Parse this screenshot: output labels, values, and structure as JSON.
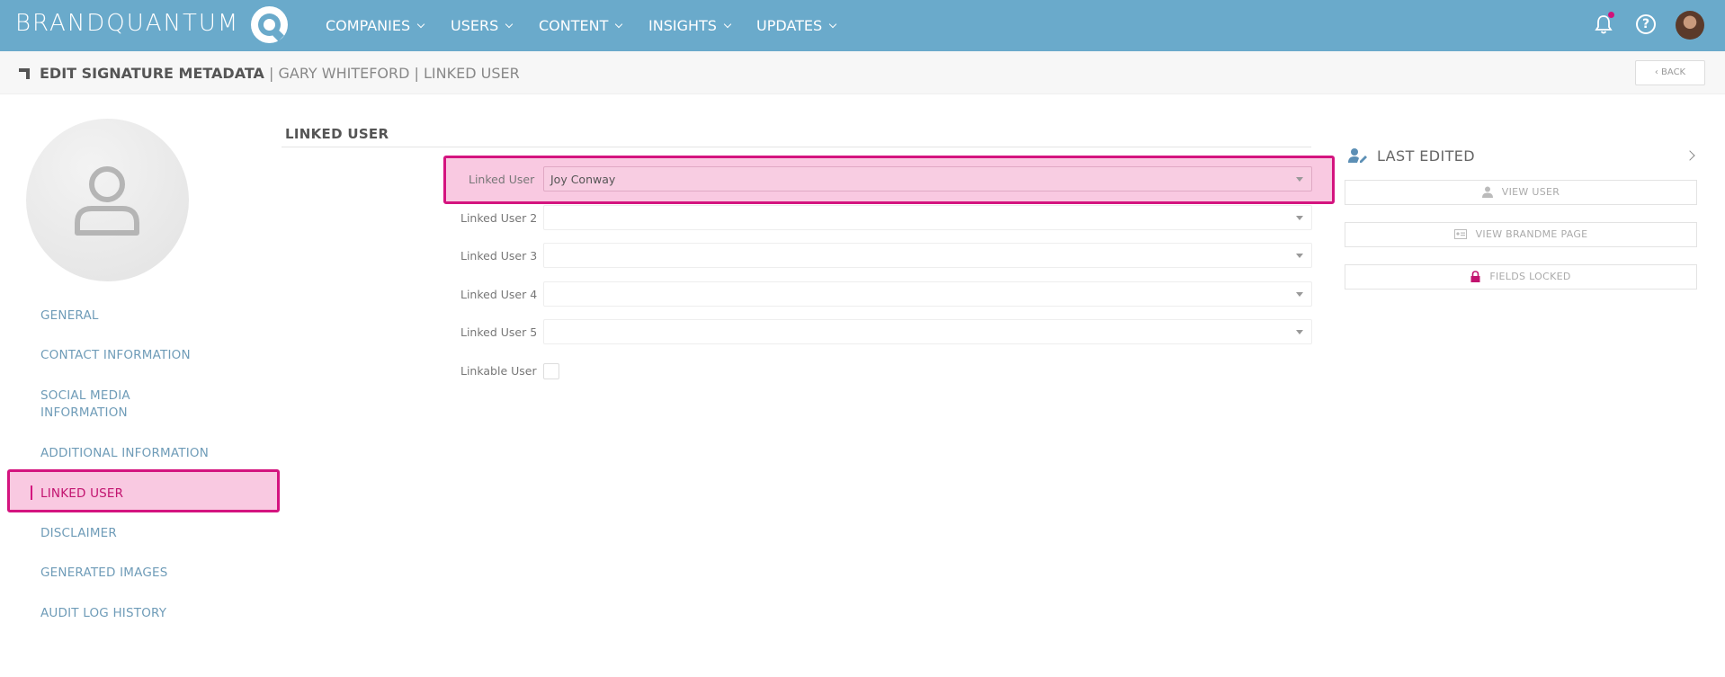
{
  "topbar": {
    "brand": "BRANDQUANTUM",
    "nav": [
      "COMPANIES",
      "USERS",
      "CONTENT",
      "INSIGHTS",
      "UPDATES"
    ]
  },
  "header": {
    "title": "EDIT SIGNATURE METADATA",
    "sep1": " | ",
    "user": "GARY WHITEFORD",
    "sep2": " | ",
    "section": "LINKED USER",
    "back_label": "BACK"
  },
  "sidebar": {
    "items": [
      {
        "label": "GENERAL"
      },
      {
        "label": "CONTACT INFORMATION"
      },
      {
        "label": "SOCIAL MEDIA"
      },
      {
        "label": "INFORMATION"
      },
      {
        "label": "ADDITIONAL INFORMATION"
      },
      {
        "label": "LINKED USER"
      },
      {
        "label": "DISCLAIMER"
      },
      {
        "label": "GENERATED IMAGES"
      },
      {
        "label": "AUDIT LOG HISTORY"
      }
    ],
    "active": "LINKED USER"
  },
  "form": {
    "section_title": "LINKED USER",
    "fields": [
      {
        "label": "Linked User",
        "value": "Joy Conway"
      },
      {
        "label": "Linked User 2",
        "value": ""
      },
      {
        "label": "Linked User 3",
        "value": ""
      },
      {
        "label": "Linked User 4",
        "value": ""
      },
      {
        "label": "Linked User 5",
        "value": ""
      }
    ],
    "linkable": {
      "label": "Linkable User",
      "checked": false
    }
  },
  "right_panel": {
    "title": "LAST EDITED",
    "buttons": [
      "VIEW USER",
      "VIEW BRANDME PAGE",
      "FIELDS LOCKED"
    ]
  },
  "colors": {
    "topbar": "#6aaacb",
    "accent": "#d4147f",
    "highlight": "#f9c9e1",
    "link": "#6f9cb8"
  }
}
